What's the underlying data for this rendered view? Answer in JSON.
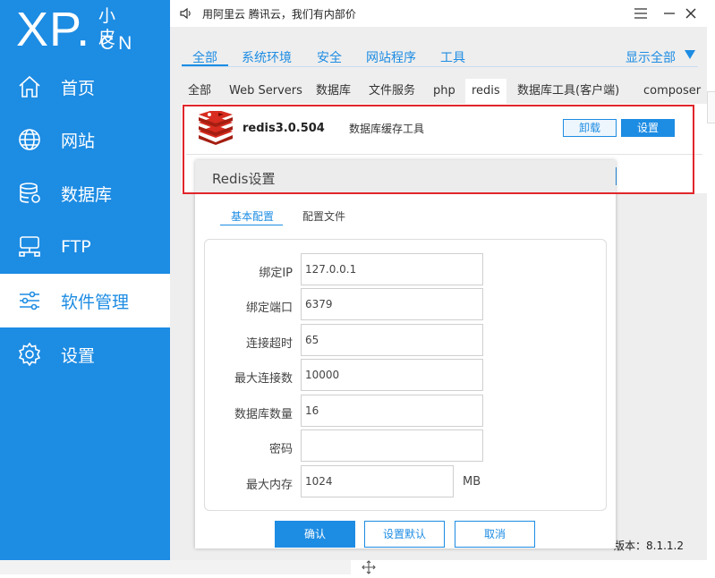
{
  "logo": {
    "main": "XP.",
    "cn_top": "小皮",
    "cn_bottom": "CN"
  },
  "sidebar": {
    "items": [
      {
        "label": "首页",
        "icon": "home-icon"
      },
      {
        "label": "网站",
        "icon": "globe-icon"
      },
      {
        "label": "数据库",
        "icon": "database-icon"
      },
      {
        "label": "FTP",
        "icon": "ftp-icon"
      },
      {
        "label": "软件管理",
        "icon": "sliders-icon",
        "active": true
      },
      {
        "label": "设置",
        "icon": "gear-icon"
      }
    ]
  },
  "topbar": {
    "notice": "用阿里云 腾讯云，我们有内部价"
  },
  "tabs_primary": [
    "全部",
    "系统环境",
    "安全",
    "网站程序",
    "工具"
  ],
  "show_all": "显示全部",
  "tabs_secondary": [
    "全部",
    "Web Servers",
    "数据库",
    "文件服务",
    "php",
    "redis",
    "数据库工具(客户端)",
    "composer"
  ],
  "software": {
    "name": "redis3.0.504",
    "description": "数据库缓存工具",
    "uninstall_label": "卸载",
    "settings_label": "设置"
  },
  "dialog": {
    "title": "Redis设置",
    "tabs": [
      "基本配置",
      "配置文件"
    ],
    "fields": [
      {
        "label": "绑定IP",
        "value": "127.0.0.1"
      },
      {
        "label": "绑定端口",
        "value": "6379"
      },
      {
        "label": "连接超时",
        "value": "65"
      },
      {
        "label": "最大连接数",
        "value": "10000"
      },
      {
        "label": "数据库数量",
        "value": "16"
      },
      {
        "label": "密码",
        "value": ""
      },
      {
        "label": "最大内存",
        "value": "1024",
        "unit": "MB"
      }
    ],
    "buttons": {
      "confirm": "确认",
      "default": "设置默认",
      "cancel": "取消"
    }
  },
  "statusbar": {
    "version": "版本：8.1.1.2"
  },
  "colors": {
    "accent": "#1d8ce3",
    "highlight_border": "#e0262b",
    "redis_red": "#c6302b"
  }
}
